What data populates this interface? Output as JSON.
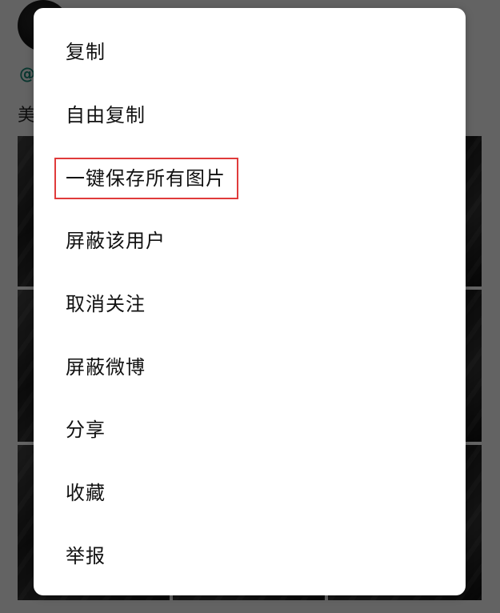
{
  "background": {
    "handle_fragment": "@",
    "text_fragment": "美"
  },
  "menu": {
    "items": [
      {
        "label": "复制"
      },
      {
        "label": "自由复制"
      },
      {
        "label": "一键保存所有图片",
        "highlighted": true
      },
      {
        "label": "屏蔽该用户"
      },
      {
        "label": "取消关注"
      },
      {
        "label": "屏蔽微博"
      },
      {
        "label": "分享"
      },
      {
        "label": "收藏"
      },
      {
        "label": "举报"
      }
    ]
  },
  "colors": {
    "overlay": "#000000",
    "menu_bg": "#ffffff",
    "highlight_border": "#e03b3b",
    "handle_accent": "#1a7a6c"
  }
}
